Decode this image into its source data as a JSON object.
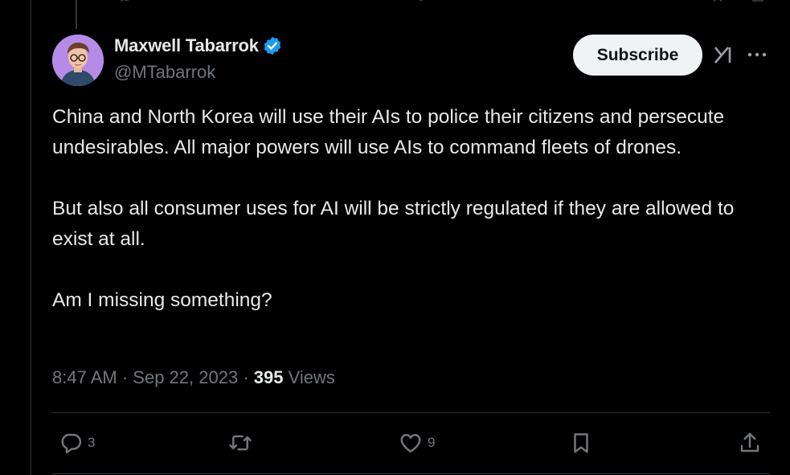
{
  "author": {
    "display_name": "Maxwell Tabarrok",
    "handle": "@MTabarrok"
  },
  "header": {
    "subscribe_label": "Subscribe"
  },
  "tweet": {
    "paragraphs": [
      "China and North Korea will use their AIs to police their citizens and persecute undesirables. All major powers will use AIs to command fleets of drones.",
      "But also all consumer uses for AI will be strictly regulated if they are allowed to exist at all.",
      "Am I missing something?"
    ],
    "time": "8:47 AM",
    "separator": "·",
    "date": "Sep 22, 2023",
    "views_count": "395",
    "views_label": "Views"
  },
  "actions": {
    "reply_count": "3",
    "like_count": "9"
  },
  "icons": {
    "verified": "verified-badge-icon",
    "grok": "grok-icon",
    "more": "more-icon",
    "reply": "reply-icon",
    "retweet": "retweet-icon",
    "like": "like-icon",
    "bookmark": "bookmark-icon",
    "share": "share-icon"
  },
  "colors": {
    "background": "#000000",
    "primary_text": "#e7e9ea",
    "secondary_text": "#71767b",
    "verified": "#1d9bf0",
    "divider": "#2f3336",
    "button_bg": "#eff3f4",
    "avatar_bg": "#b68be8"
  }
}
